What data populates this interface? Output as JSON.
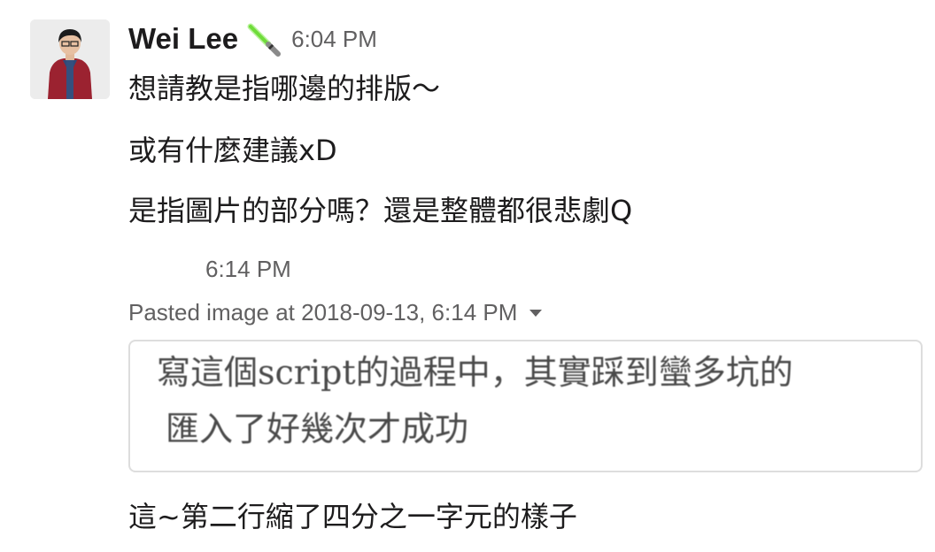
{
  "message": {
    "author": "Wei Lee",
    "status_emoji": "lightsaber-icon",
    "timestamp": "6:04 PM",
    "lines": [
      "想請教是指哪邊的排版～",
      "或有什麼建議xD",
      "是指圖片的部分嗎？還是整體都很悲劇Q"
    ]
  },
  "continuation": {
    "timestamp": "6:14 PM"
  },
  "attachment": {
    "title": "Pasted image at 2018-09-13, 6:14 PM",
    "menu_icon": "caret-down-icon",
    "image_lines": [
      "寫這個script的過程中，其實踩到蠻多坑的",
      "匯入了好幾次才成功"
    ]
  },
  "followup": {
    "text": "這~第二行縮了四分之一字元的樣子"
  },
  "colors": {
    "text": "#1d1c1d",
    "muted": "#616061",
    "border": "#dddddd",
    "lightsaber": "#6fdc3a"
  }
}
